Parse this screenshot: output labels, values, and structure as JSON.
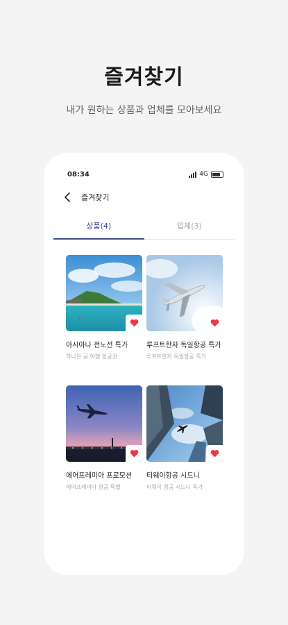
{
  "hero": {
    "title": "즐겨찾기",
    "subtitle": "내가 원하는 상품과 업체를 모아보세요"
  },
  "status_bar": {
    "time": "08:34",
    "network": "4G"
  },
  "header": {
    "title": "즐겨찾기"
  },
  "tabs": [
    {
      "label": "상품(4)",
      "active": true
    },
    {
      "label": "업체(3)",
      "active": false
    }
  ],
  "cards": [
    {
      "title": "아시아나 전노선 특가",
      "subtitle": "하나은 공 여행 항공권",
      "image": "coastal-island-photo",
      "favorited": true
    },
    {
      "title": "루프트한자 독일항공 특가",
      "subtitle": "루프트한자 독일항공 특가",
      "image": "airplane-sky-photo",
      "favorited": true
    },
    {
      "title": "에어프레미아 프로모션",
      "subtitle": "에어프레미아 항공 특별",
      "image": "airplane-sunset-photo",
      "favorited": true
    },
    {
      "title": "티웨이항공 시드니",
      "subtitle": "티웨이 항공 시드니 특가",
      "image": "skyscrapers-airplane-photo",
      "favorited": true
    }
  ],
  "colors": {
    "accent": "#3b4b8c",
    "heart": "#e8394a",
    "background": "#f4f4f4"
  }
}
